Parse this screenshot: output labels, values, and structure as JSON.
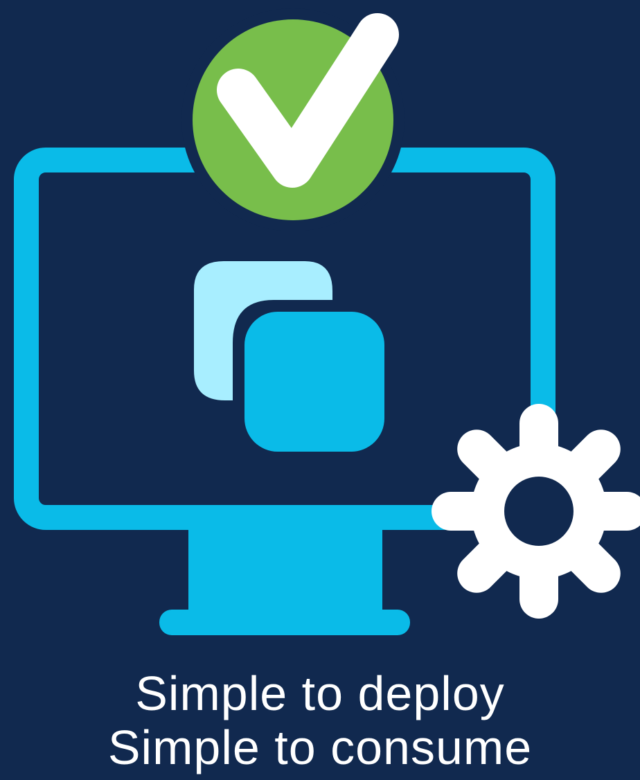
{
  "caption": {
    "line1": "Simple to deploy",
    "line2": "Simple to consume"
  },
  "colors": {
    "background": "#11294f",
    "monitor": "#0abbe8",
    "window_back": "#a8eeff",
    "window_front": "#0abbe8",
    "check_badge": "#78be4b",
    "check_mark": "#ffffff",
    "gear": "#ffffff"
  },
  "icons": {
    "monitor": "monitor-icon",
    "windows": "stacked-windows-icon",
    "check": "checkmark-badge-icon",
    "gear": "gear-icon"
  }
}
